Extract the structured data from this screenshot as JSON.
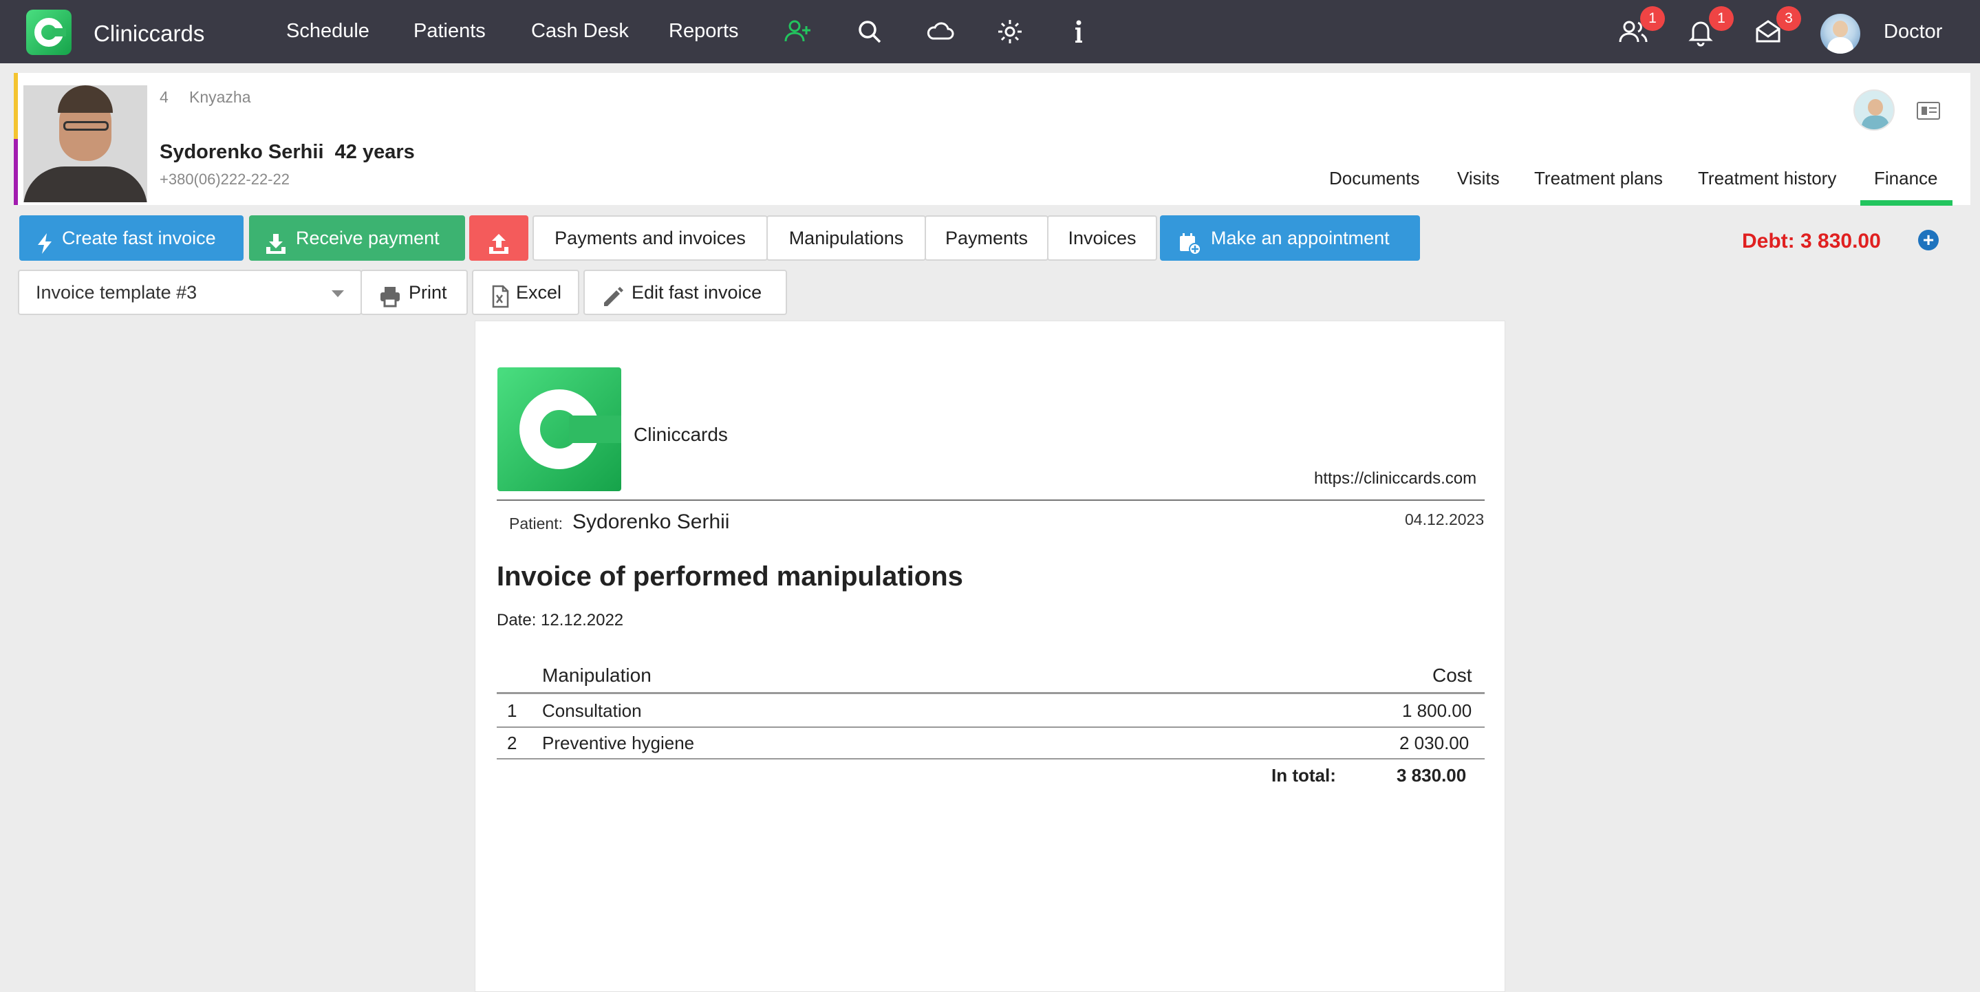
{
  "app": {
    "brand": "Cliniccards",
    "user_name": "Doctor"
  },
  "nav": [
    "Schedule",
    "Patients",
    "Cash Desk",
    "Reports"
  ],
  "top_icons": [
    "add-patient-icon",
    "search-icon",
    "cloud-icon",
    "settings-icon",
    "info-icon"
  ],
  "badges": {
    "patients": "1",
    "notifications": "1",
    "messages": "3"
  },
  "patient": {
    "id": "4",
    "branch": "Knyazha",
    "name": "Sydorenko Serhii",
    "age": "42 years",
    "phone": "+380(06)222-22-22"
  },
  "patient_tabs": [
    "Documents",
    "Visits",
    "Treatment plans",
    "Treatment history",
    "Finance"
  ],
  "active_tab": "Finance",
  "toolbar": {
    "create_fast_invoice": "Create fast invoice",
    "receive_payment": "Receive payment",
    "upload_icon": "upload-icon",
    "filters": [
      "Payments and invoices",
      "Manipulations",
      "Payments",
      "Invoices"
    ],
    "make_appointment": "Make an appointment",
    "debt": "Debt: 3 830.00"
  },
  "template": {
    "selected": "Invoice template #3",
    "print": "Print",
    "excel": "Excel",
    "edit_fast_invoice": "Edit fast invoice"
  },
  "invoice": {
    "brand": "Cliniccards",
    "url": "https://cliniccards.com",
    "patient_label": "Patient:",
    "patient_name": "Sydorenko Serhii",
    "issue_date": "04.12.2023",
    "title": "Invoice of performed manipulations",
    "date_line": "Date: 12.12.2022",
    "columns": {
      "manipulation": "Manipulation",
      "cost": "Cost"
    },
    "rows": [
      {
        "no": "1",
        "manipulation": "Consultation",
        "cost": "1 800.00"
      },
      {
        "no": "2",
        "manipulation": "Preventive hygiene",
        "cost": "2 030.00"
      }
    ],
    "total_label": "In total:",
    "total_value": "3 830.00"
  },
  "colors": {
    "topbar": "#3a3a45",
    "blue_button": "#3498db",
    "green_button": "#3cb371",
    "red_button": "#f45b5b",
    "debt": "#e02020",
    "active_tab_underline": "#22c55e"
  }
}
